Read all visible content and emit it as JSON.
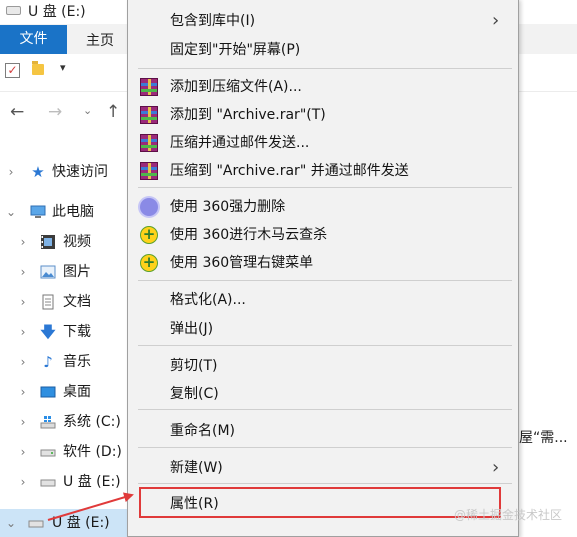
{
  "window": {
    "title": "U 盘 (E:)",
    "title_icon": "usb-drive-icon"
  },
  "ribbon": {
    "tab_file": "文件",
    "tab_home": "主页",
    "accent": "#1a73c7"
  },
  "quick_access_toolbar": {
    "properties_icon": "checkbox-properties-icon",
    "new_folder_icon": "folder-icon",
    "customize_icon": "dropdown-icon"
  },
  "navigation": {
    "back_icon": "arrow-left-icon",
    "forward_icon": "arrow-right-icon",
    "recent_icon": "chevron-down-icon",
    "up_icon": "arrow-up-icon"
  },
  "tree": [
    {
      "label": "快速访问",
      "icon": "star-icon"
    },
    {
      "label": "此电脑",
      "icon": "computer-icon"
    },
    {
      "label": "视频",
      "icon": "video-icon"
    },
    {
      "label": "图片",
      "icon": "picture-icon"
    },
    {
      "label": "文档",
      "icon": "document-icon"
    },
    {
      "label": "下载",
      "icon": "download-icon"
    },
    {
      "label": "音乐",
      "icon": "music-icon"
    },
    {
      "label": "桌面",
      "icon": "desktop-icon"
    },
    {
      "label": "系统 (C:)",
      "icon": "windows-drive-icon"
    },
    {
      "label": "软件 (D:)",
      "icon": "drive-icon"
    },
    {
      "label": "U 盘 (E:)",
      "icon": "usb-drive-icon"
    },
    {
      "label": "U 盘 (E:)",
      "icon": "usb-drive-icon"
    }
  ],
  "context_menu": {
    "items": [
      {
        "label": "包含到库中(I)",
        "has_submenu": true
      },
      {
        "label": "固定到\"开始\"屏幕(P)"
      },
      {
        "label": "添加到压缩文件(A)...",
        "icon": "winrar-icon"
      },
      {
        "label": "添加到 \"Archive.rar\"(T)",
        "icon": "winrar-icon"
      },
      {
        "label": "压缩并通过邮件发送...",
        "icon": "winrar-icon"
      },
      {
        "label": "压缩到 \"Archive.rar\" 并通过邮件发送",
        "icon": "winrar-icon"
      },
      {
        "label": "使用 360强力删除",
        "icon": "360-delete-icon"
      },
      {
        "label": "使用 360进行木马云查杀",
        "icon": "360-security-icon"
      },
      {
        "label": "使用 360管理右键菜单",
        "icon": "360-security-icon"
      },
      {
        "label": "格式化(A)..."
      },
      {
        "label": "弹出(J)"
      },
      {
        "label": "剪切(T)"
      },
      {
        "label": "复制(C)"
      },
      {
        "label": "重命名(M)"
      },
      {
        "label": "新建(W)",
        "has_submenu": true
      },
      {
        "label": "属性(R)",
        "highlighted": true
      }
    ],
    "highlight_color": "#e03a3a"
  },
  "background_text": "屋“需...",
  "watermark": "@稀土掘金技术社区"
}
